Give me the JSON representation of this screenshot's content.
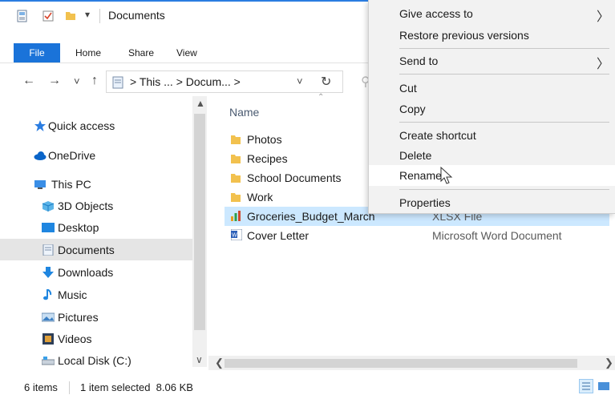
{
  "window": {
    "title": "Documents",
    "quick_access_dropdown": "▾"
  },
  "ribbon": {
    "tabs": [
      {
        "label": "File",
        "active": true
      },
      {
        "label": "Home"
      },
      {
        "label": "Share"
      },
      {
        "label": "View"
      }
    ]
  },
  "navigation": {
    "back": "←",
    "forward": "→",
    "recent": "˅",
    "up": "↑",
    "address": "> This ... > Docum... >",
    "dropdown": "˅",
    "refresh": "↻"
  },
  "sidebar": {
    "items": [
      {
        "label": "Quick access",
        "icon": "star-icon"
      },
      {
        "label": "OneDrive",
        "icon": "cloud-icon"
      },
      {
        "label": "This PC",
        "icon": "computer-icon"
      },
      {
        "label": "3D Objects",
        "icon": "cube-icon"
      },
      {
        "label": "Desktop",
        "icon": "desktop-icon"
      },
      {
        "label": "Documents",
        "icon": "documents-icon",
        "selected": true
      },
      {
        "label": "Downloads",
        "icon": "download-icon"
      },
      {
        "label": "Music",
        "icon": "music-icon"
      },
      {
        "label": "Pictures",
        "icon": "pictures-icon"
      },
      {
        "label": "Videos",
        "icon": "videos-icon"
      },
      {
        "label": "Local Disk (C:)",
        "icon": "disk-icon"
      }
    ]
  },
  "file_list": {
    "column_name": "Name",
    "files": [
      {
        "name": "Photos",
        "type": "",
        "icon": "folder-icon"
      },
      {
        "name": "Recipes",
        "type": "",
        "icon": "folder-icon"
      },
      {
        "name": "School Documents",
        "type": "",
        "icon": "folder-icon"
      },
      {
        "name": "Work",
        "type": "",
        "icon": "folder-icon"
      },
      {
        "name": "Groceries_Budget_March",
        "type": "XLSX File",
        "icon": "excel-icon",
        "selected": true
      },
      {
        "name": "Cover Letter",
        "type": "Microsoft Word Document",
        "icon": "word-icon"
      }
    ]
  },
  "status": {
    "item_count": "6 items",
    "selection": "1 item selected  8.06 KB"
  },
  "context_menu": {
    "items": [
      {
        "label": "Give access to",
        "submenu": true
      },
      {
        "label": "Restore previous versions"
      },
      {
        "label": "Send to",
        "submenu": true
      },
      {
        "label": "Cut"
      },
      {
        "label": "Copy"
      },
      {
        "label": "Create shortcut"
      },
      {
        "label": "Delete"
      },
      {
        "label": "Rename",
        "hovered": true
      },
      {
        "label": "Properties"
      }
    ],
    "submenu_arrow": "〉"
  },
  "colors": {
    "accent": "#1a73d9",
    "selection": "#cce8ff",
    "folder": "#f2c14e"
  }
}
